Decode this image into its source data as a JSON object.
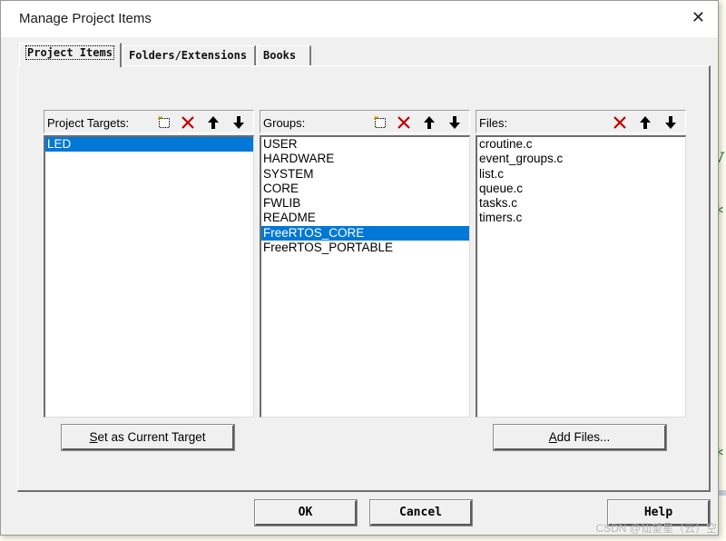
{
  "window": {
    "title": "Manage Project Items",
    "close_glyph": "✕"
  },
  "tabs": [
    {
      "label": "Project Items",
      "active": true
    },
    {
      "label": "Folders/Extensions",
      "active": false
    },
    {
      "label": "Books",
      "active": false
    }
  ],
  "targets": {
    "title": "Project Targets:",
    "items": [
      "LED"
    ],
    "selected": "LED"
  },
  "groups": {
    "title": "Groups:",
    "items": [
      "USER",
      "HARDWARE",
      "SYSTEM",
      "CORE",
      "FWLIB",
      "README",
      "FreeRTOS_CORE",
      "FreeRTOS_PORTABLE"
    ],
    "selected": "FreeRTOS_CORE"
  },
  "files": {
    "title": "Files:",
    "items": [
      "croutine.c",
      "event_groups.c",
      "list.c",
      "queue.c",
      "tasks.c",
      "timers.c"
    ]
  },
  "toolbar_icons": {
    "new": "new-item-icon",
    "delete": "delete-x-icon",
    "up": "move-up-arrow-icon",
    "down": "move-down-arrow-icon"
  },
  "buttons": {
    "set_target_mnemonic": "S",
    "set_target_rest": "et as Current Target",
    "add_files_mnemonic": "A",
    "add_files_rest": "dd Files...",
    "ok": "OK",
    "cancel": "Cancel",
    "help": "Help"
  },
  "watermark": "CSDN @仙望星（云）空",
  "colors": {
    "selection": "#0078d7",
    "delete_icon": "#c00000",
    "face": "#f0f0f0"
  }
}
